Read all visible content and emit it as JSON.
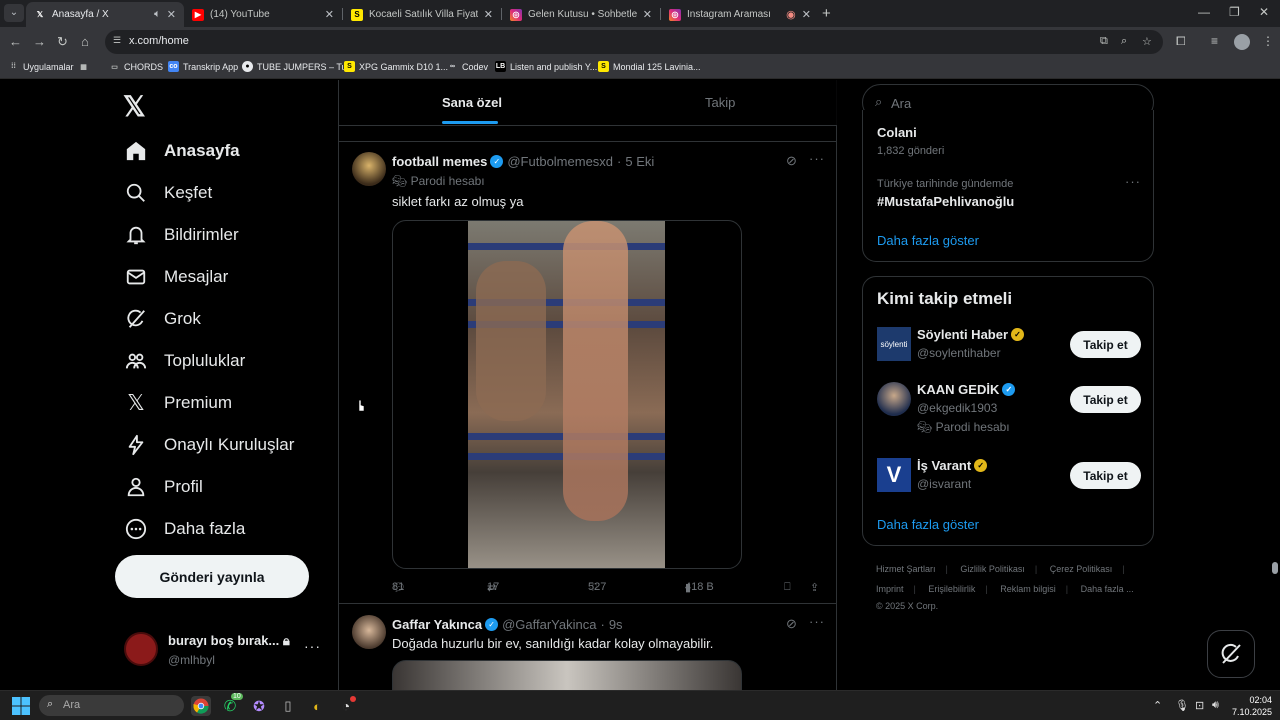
{
  "browser": {
    "tabs": [
      {
        "title": "Anasayfa / X",
        "icon": "x-logo-icon",
        "active": true
      },
      {
        "title": "(14) YouTube",
        "icon": "youtube-icon",
        "active": false
      },
      {
        "title": "Kocaeli Satılık Villa Fiyatları ve",
        "icon": "sahibinden-icon",
        "active": false
      },
      {
        "title": "Gelen Kutusu • Sohbetler",
        "icon": "instagram-icon",
        "active": false
      },
      {
        "title": "Instagram Araması",
        "icon": "instagram-icon",
        "active": false
      }
    ],
    "url": "x.com/home",
    "bookmarks": [
      {
        "label": "Uygulamalar",
        "icon": "apps-grid-icon"
      },
      {
        "label": "CHORDS",
        "icon": "folder-icon"
      },
      {
        "label": "Transkrip App",
        "icon": "transkrip-icon"
      },
      {
        "label": "TUBE JUMPERS – Tu...",
        "icon": "globe-icon"
      },
      {
        "label": "XPG Gammix D10 1...",
        "icon": "sahibinden-icon"
      },
      {
        "label": "Codev",
        "icon": "codev-icon"
      },
      {
        "label": "Listen and publish Y...",
        "icon": "lb-icon"
      },
      {
        "label": "Mondial 125 Lavinia...",
        "icon": "sahibinden-icon"
      }
    ]
  },
  "sidebar": {
    "items": [
      {
        "label": "Anasayfa",
        "icon": "home-icon"
      },
      {
        "label": "Keşfet",
        "icon": "search-icon"
      },
      {
        "label": "Bildirimler",
        "icon": "bell-icon"
      },
      {
        "label": "Mesajlar",
        "icon": "envelope-icon"
      },
      {
        "label": "Grok",
        "icon": "grok-icon"
      },
      {
        "label": "Topluluklar",
        "icon": "communities-icon"
      },
      {
        "label": "Premium",
        "icon": "x-logo-icon"
      },
      {
        "label": "Onaylı Kuruluşlar",
        "icon": "lightning-icon"
      },
      {
        "label": "Profil",
        "icon": "person-icon"
      },
      {
        "label": "Daha fazla",
        "icon": "more-circle-icon"
      }
    ],
    "post_button": "Gönderi yayınla",
    "account": {
      "name": "burayı boş bırak...",
      "handle": "@mlhbyl"
    }
  },
  "feed": {
    "tabs": [
      "Sana özel",
      "Takip"
    ],
    "tweets": [
      {
        "name": "football memes",
        "handle": "@Futbolmemesxd",
        "time": "5 Eki",
        "tag": "Parodi hesabı",
        "text": "siklet farkı az olmuş ya",
        "replies": "81",
        "reposts": "17",
        "likes": "527",
        "views": "418 B"
      },
      {
        "name": "Gaffar Yakınca",
        "handle": "@GaffarYakinca",
        "time": "9s",
        "text": "Doğada huzurlu bir ev, sanıldığı kadar kolay olmayabilir."
      }
    ]
  },
  "right": {
    "search_placeholder": "Ara",
    "trends": [
      {
        "name": "Colani",
        "meta": "1,832 gönderi"
      },
      {
        "context": "Türkiye tarihinde gündemde",
        "name": "#MustafaPehlivanoğlu"
      }
    ],
    "show_more": "Daha fazla göster",
    "who_to_follow": {
      "title": "Kimi takip etmeli",
      "follow_label": "Takip et",
      "suggestions": [
        {
          "name": "Söylenti Haber",
          "handle": "@soylentihaber",
          "badge": "gold"
        },
        {
          "name": "KAAN GEDİK",
          "handle": "@ekgedik1903",
          "badge": "blue",
          "tag": "Parodi hesabı"
        },
        {
          "name": "İş Varant",
          "handle": "@isvarant",
          "badge": "gold"
        }
      ],
      "show_more": "Daha fazla göster"
    },
    "footer": {
      "line1": [
        "Hizmet Şartları",
        "Gizlilik Politikası",
        "Çerez Politikası"
      ],
      "line2": [
        "Imprint",
        "Erişilebilirlik",
        "Reklam bilgisi",
        "Daha fazla ..."
      ],
      "copyright": "© 2025 X Corp."
    }
  },
  "taskbar": {
    "search_placeholder": "Ara",
    "time": "02:04",
    "date": "7.10.2025",
    "whatsapp_badge": "10"
  },
  "colors": {
    "accent": "#1d9bf0",
    "background": "#000000",
    "gold_badge": "#e2b719"
  }
}
